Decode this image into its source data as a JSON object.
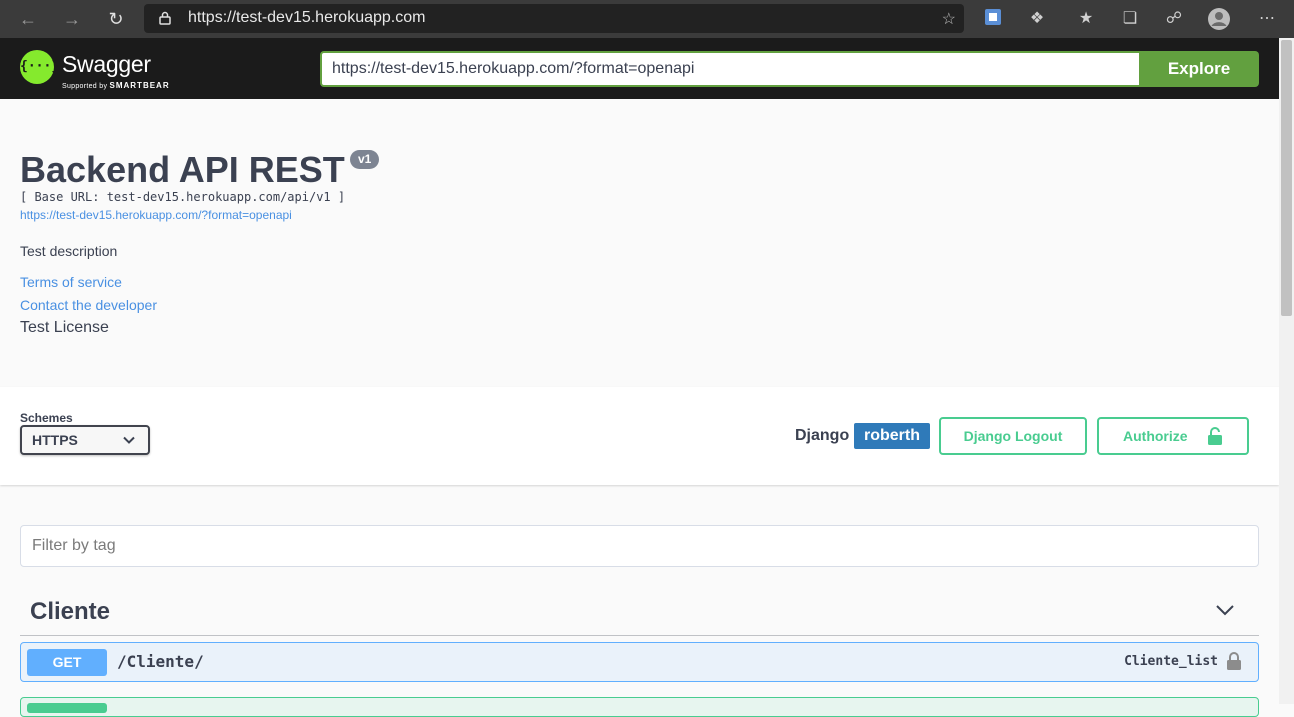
{
  "browser": {
    "url": "https://test-dev15.herokuapp.com"
  },
  "topbar": {
    "logo_text": "Swagger",
    "logo_sub_prefix": "Supported by",
    "logo_sub_brand": "SMARTBEAR",
    "spec_url": "https://test-dev15.herokuapp.com/?format=openapi",
    "explore_label": "Explore"
  },
  "info": {
    "title": "Backend API REST",
    "version": "v1",
    "base_url": "[ Base URL: test-dev15.herokuapp.com/api/v1 ]",
    "spec_link": "https://test-dev15.herokuapp.com/?format=openapi",
    "description": "Test description",
    "terms": "Terms of service",
    "contact": "Contact the developer",
    "license": "Test License"
  },
  "schemes": {
    "label": "Schemes",
    "selected": "HTTPS"
  },
  "auth": {
    "django_label": "Django",
    "username": "roberth",
    "logout_label": "Django Logout",
    "authorize_label": "Authorize"
  },
  "filter": {
    "placeholder": "Filter by tag"
  },
  "tags": [
    {
      "name": "Cliente",
      "operations": [
        {
          "method": "GET",
          "path": "/Cliente/",
          "operation_id": "Cliente_list"
        }
      ]
    }
  ],
  "colors": {
    "get": "#61affe",
    "post": "#49cc90",
    "swagger_green": "#85ea2d",
    "explore_green": "#62a03f",
    "link_blue": "#4990e2"
  }
}
